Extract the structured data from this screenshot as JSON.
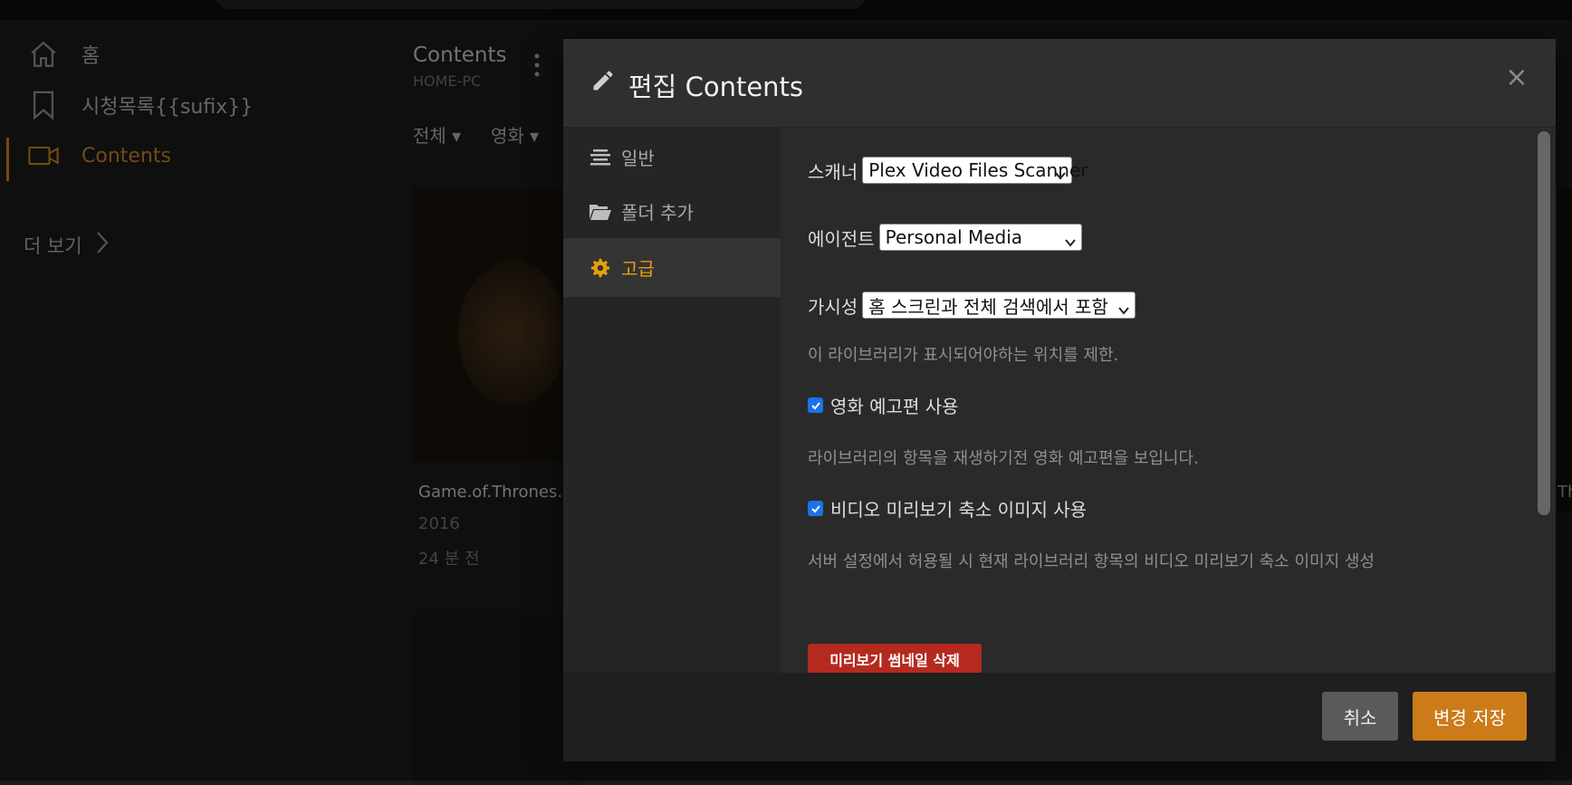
{
  "sidebar": {
    "items": [
      {
        "label": "홈",
        "icon": "home-icon"
      },
      {
        "label": "시청목록{{sufix}}",
        "icon": "bookmark-icon"
      },
      {
        "label": "Contents",
        "icon": "video-camera-icon"
      }
    ],
    "more_label": "더 보기"
  },
  "library": {
    "title": "Contents",
    "server": "HOME-PC",
    "filters": [
      "전체",
      "영화"
    ],
    "card": {
      "title": "Game.of.Thrones.S",
      "year": "2016",
      "added": "24 분 전"
    },
    "right_card_text": "Thr"
  },
  "modal": {
    "title": "편집 Contents",
    "close_label": "×",
    "tabs": [
      {
        "label": "일반",
        "icon": "align-center-icon"
      },
      {
        "label": "폴더 추가",
        "icon": "folder-open-icon"
      },
      {
        "label": "고급",
        "icon": "gear-icon"
      }
    ],
    "active_tab": "고급",
    "fields": {
      "scanner": {
        "label": "스캐너",
        "value": "Plex Video Files Scanner"
      },
      "agent": {
        "label": "에이전트",
        "value": "Personal Media"
      },
      "visibility": {
        "label": "가시성",
        "value": "홈 스크린과 전체 검색에서 포함",
        "help": "이 라이브러리가 표시되어야하는 위치를 제한."
      },
      "trailers": {
        "label": "영화 예고편 사용",
        "checked": true,
        "help": "라이브러리의 항목을 재생하기전 영화 예고편을 보입니다."
      },
      "thumbnails": {
        "label": "비디오 미리보기 축소 이미지 사용",
        "checked": true,
        "help": "서버 설정에서 허용될 시 현재 라이브러리 항목의 비디오 미리보기 축소 이미지 생성"
      }
    },
    "delete_thumbnails_label": "미리보기 썸네일 삭제",
    "footer": {
      "cancel_label": "취소",
      "save_label": "변경 저장"
    }
  },
  "colors": {
    "accent": "#cc8a1f",
    "active_tab": "#e5a00d",
    "danger": "#b52a1f",
    "save": "#cc7b19",
    "checkbox": "#1a73e8"
  }
}
